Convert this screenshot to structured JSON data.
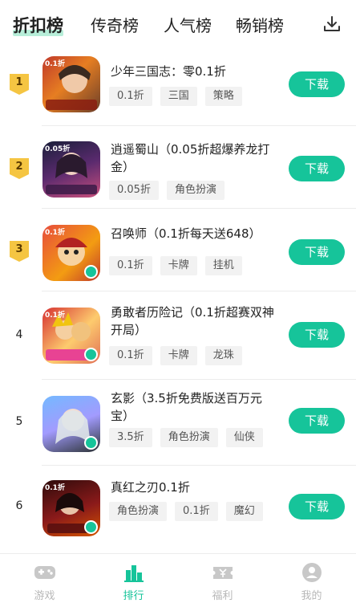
{
  "tabs": [
    {
      "label": "折扣榜",
      "active": true
    },
    {
      "label": "传奇榜",
      "active": false
    },
    {
      "label": "人气榜",
      "active": false
    },
    {
      "label": "畅销榜",
      "active": false
    }
  ],
  "games": [
    {
      "rank": "1",
      "title": "少年三国志：零0.1折",
      "tags": [
        "0.1折",
        "三国",
        "策略"
      ],
      "icon_tag": "0.1折",
      "download_label": "下载"
    },
    {
      "rank": "2",
      "title": "逍遥蜀山（0.05折超爆养龙打金）",
      "tags": [
        "0.05折",
        "角色扮演"
      ],
      "icon_tag": "0.05折",
      "download_label": "下载"
    },
    {
      "rank": "3",
      "title": "召唤师（0.1折每天送648）",
      "tags": [
        "0.1折",
        "卡牌",
        "挂机"
      ],
      "icon_tag": "0.1折",
      "download_label": "下载"
    },
    {
      "rank": "4",
      "title": "勇敢者历险记（0.1折超赛双神开局）",
      "tags": [
        "0.1折",
        "卡牌",
        "龙珠"
      ],
      "icon_tag": "0.1折",
      "download_label": "下载"
    },
    {
      "rank": "5",
      "title": "玄影（3.5折免费版送百万元宝）",
      "tags": [
        "3.5折",
        "角色扮演",
        "仙侠"
      ],
      "icon_tag": "",
      "download_label": "下载"
    },
    {
      "rank": "6",
      "title": "真红之刃0.1折",
      "tags": [
        "角色扮演",
        "0.1折",
        "魔幻"
      ],
      "icon_tag": "0.1折",
      "download_label": "下载"
    }
  ],
  "nav": [
    {
      "label": "游戏",
      "icon": "gamepad-icon",
      "active": false
    },
    {
      "label": "排行",
      "icon": "bar-chart-icon",
      "active": true
    },
    {
      "label": "福利",
      "icon": "ticket-icon",
      "active": false
    },
    {
      "label": "我的",
      "icon": "user-icon",
      "active": false
    }
  ],
  "colors": {
    "accent": "#16c49a",
    "rank_badge": "#f5c542",
    "tab_highlight": "#b7eed9"
  }
}
